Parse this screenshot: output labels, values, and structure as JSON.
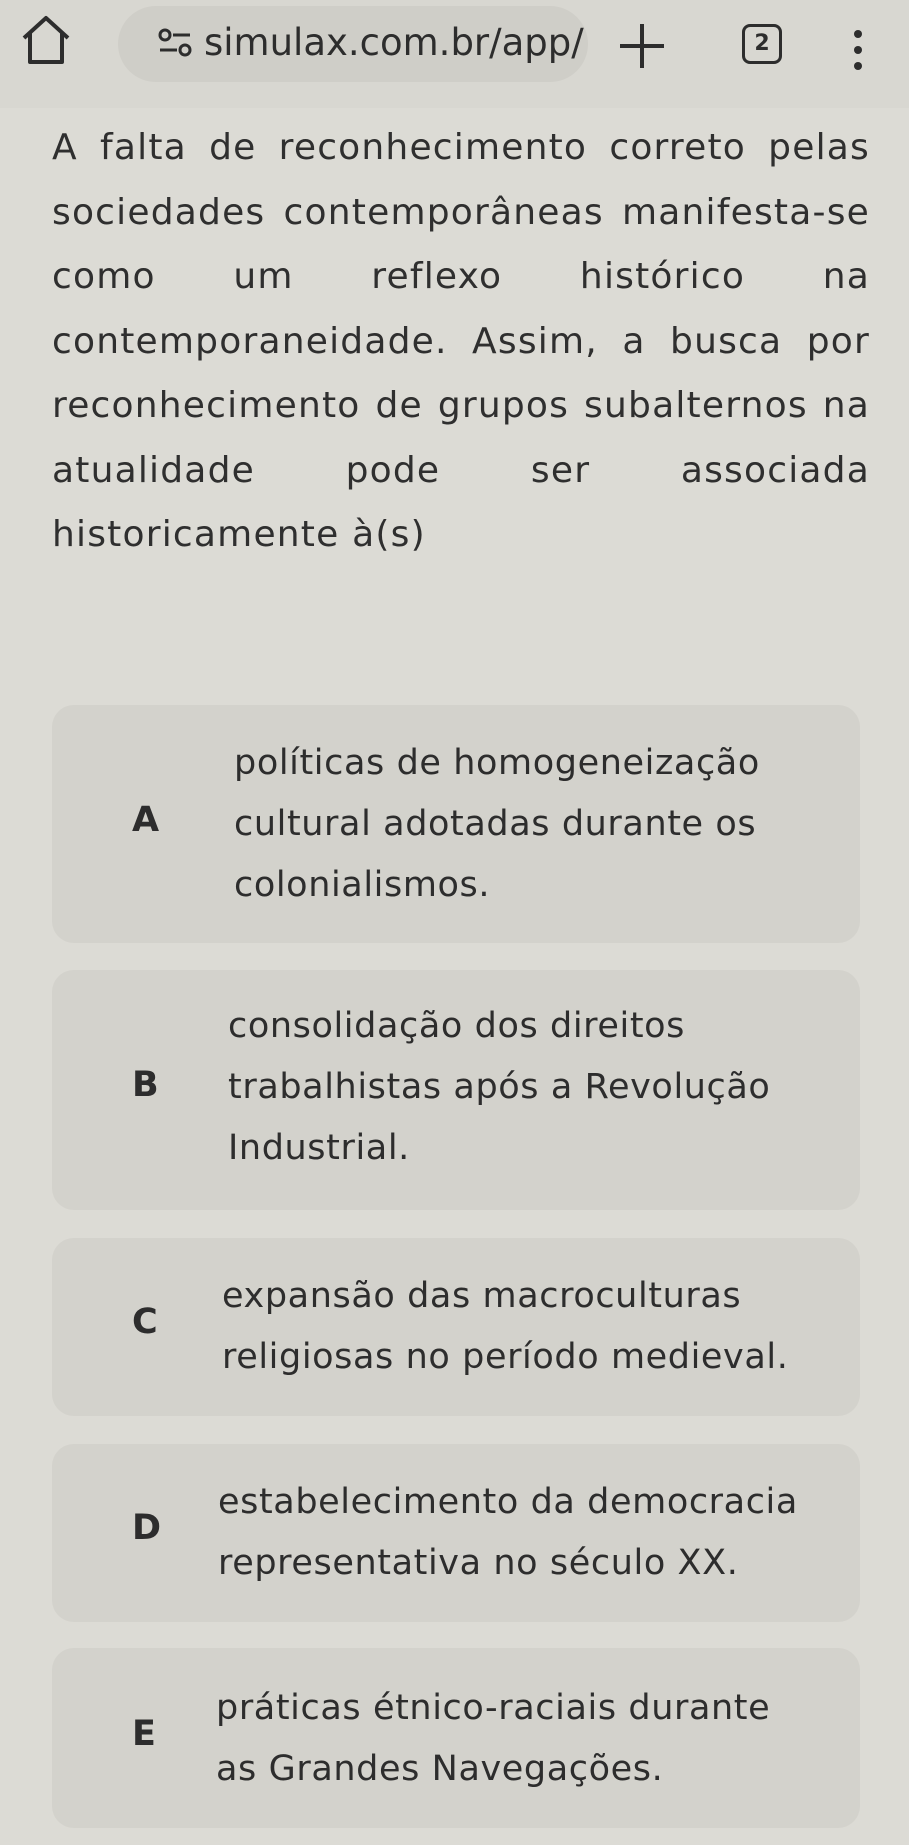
{
  "browser": {
    "url": "simulax.com.br/app/",
    "tab_count": "2",
    "home_icon": "home-icon",
    "site_info_icon": "site-settings-icon",
    "new_tab_icon": "plus-icon",
    "menu_icon": "more-vert-icon"
  },
  "question": {
    "text": "A falta de reconhecimento correto pelas sociedades contemporâneas manifesta-se como um reflexo histórico na contemporaneidade. Assim, a busca por reconhecimento de grupos subalternos na atualidade pode ser associada historicamente à(s)"
  },
  "options": [
    {
      "letter": "A",
      "text": "políticas de homogeneização cultural adotadas durante os colonialismos."
    },
    {
      "letter": "B",
      "text": "consolidação dos direitos trabalhistas após a Revolução Industrial."
    },
    {
      "letter": "C",
      "text": "expansão das macroculturas religiosas no período medieval."
    },
    {
      "letter": "D",
      "text": "estabelecimento da democracia representativa no século XX."
    },
    {
      "letter": "E",
      "text": "práticas étnico-raciais durante as Grandes Navegações."
    }
  ],
  "colors": {
    "background": "#dcdbd5",
    "option_card": "#d3d2cc",
    "text": "#2d2d2d"
  }
}
